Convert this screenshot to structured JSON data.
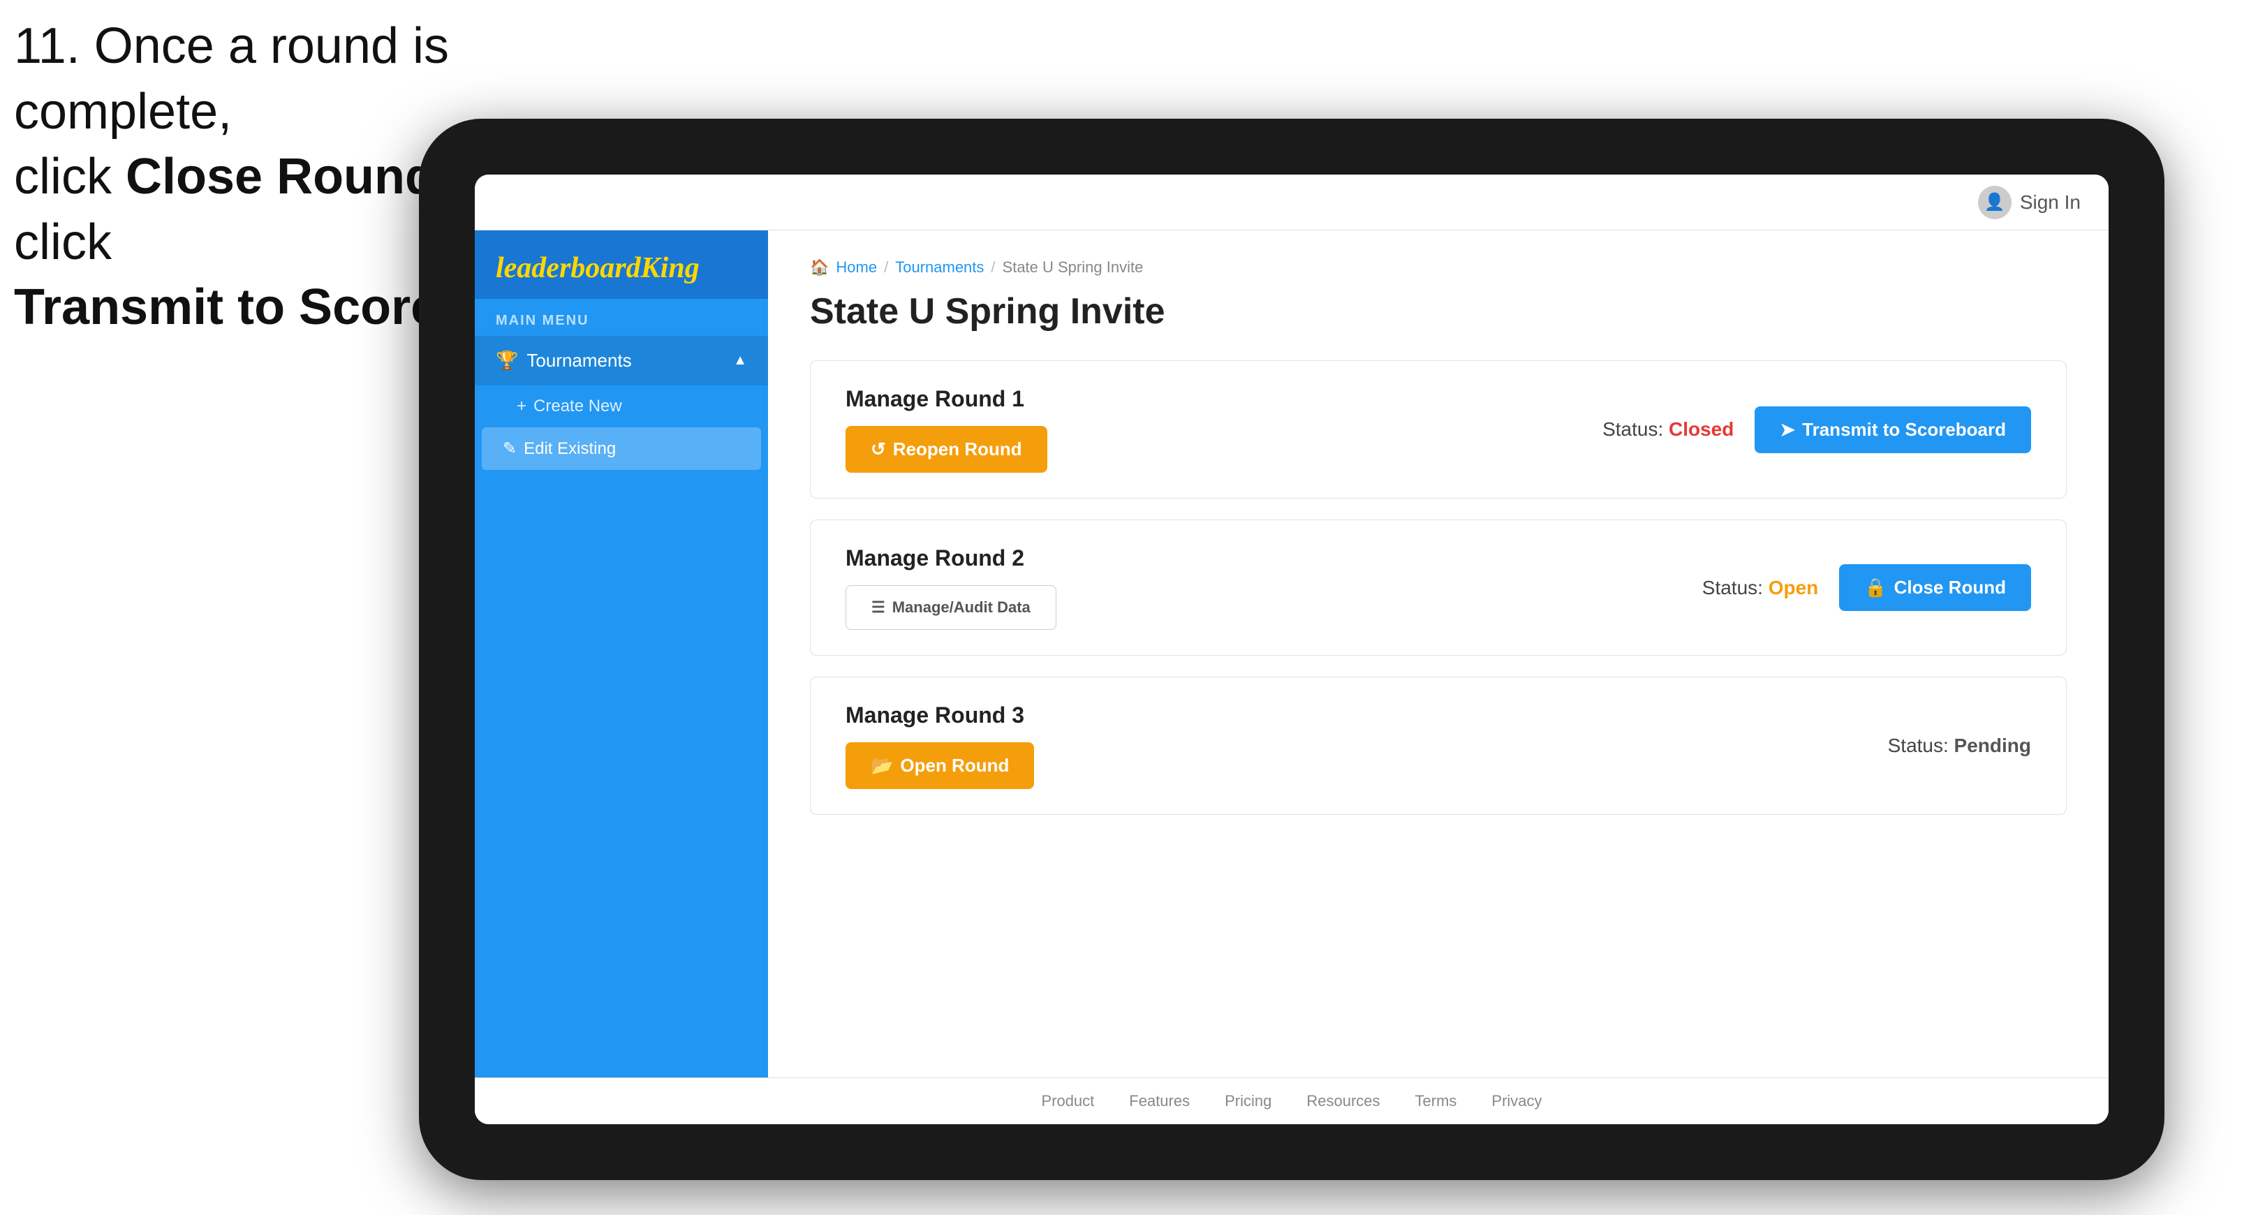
{
  "instruction": {
    "line1": "11. Once a round is complete,",
    "line2_prefix": "click ",
    "line2_bold": "Close Round",
    "line2_suffix": " then click",
    "line3": "Transmit to Scoreboard."
  },
  "header": {
    "sign_in_label": "Sign In"
  },
  "logo": {
    "text_regular": "leaderboard",
    "text_bold": "King"
  },
  "sidebar": {
    "main_menu_label": "MAIN MENU",
    "tournaments_label": "Tournaments",
    "create_new_label": "Create New",
    "edit_existing_label": "Edit Existing"
  },
  "breadcrumb": {
    "home": "Home",
    "tournaments": "Tournaments",
    "current": "State U Spring Invite"
  },
  "page": {
    "title": "State U Spring Invite"
  },
  "rounds": [
    {
      "title": "Manage Round 1",
      "status_label": "Status:",
      "status_value": "Closed",
      "status_class": "status-closed",
      "btn1_label": "Reopen Round",
      "btn1_class": "btn-orange",
      "btn2_label": "Transmit to Scoreboard",
      "btn2_class": "btn-blue"
    },
    {
      "title": "Manage Round 2",
      "status_label": "Status:",
      "status_value": "Open",
      "status_class": "status-open",
      "btn1_label": "Manage/Audit Data",
      "btn1_class": "btn-outline",
      "btn2_label": "Close Round",
      "btn2_class": "btn-blue"
    },
    {
      "title": "Manage Round 3",
      "status_label": "Status:",
      "status_value": "Pending",
      "status_class": "status-pending",
      "btn1_label": "Open Round",
      "btn1_class": "btn-orange",
      "btn2_label": "",
      "btn2_class": ""
    }
  ],
  "footer": {
    "links": [
      "Product",
      "Features",
      "Pricing",
      "Resources",
      "Terms",
      "Privacy"
    ]
  }
}
